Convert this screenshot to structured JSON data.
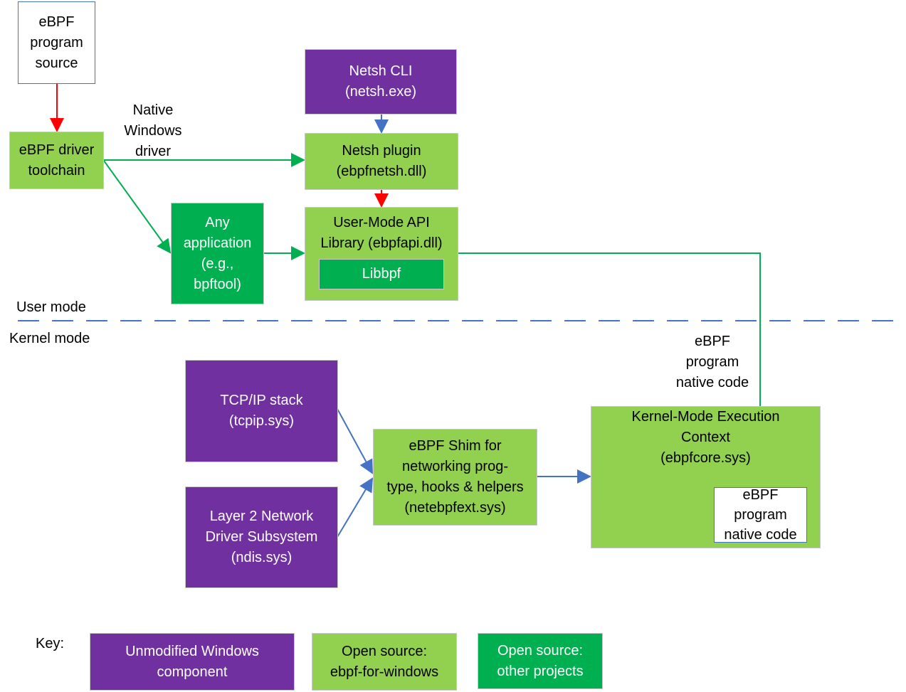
{
  "colors": {
    "unmodified": "#7030a0",
    "ebpf_for_windows": "#92d050",
    "other_projects": "#00b050",
    "arrow_blue": "#4472c4",
    "arrow_red": "#ff0000",
    "arrow_green": "#00b050"
  },
  "nodes": {
    "source": "eBPF\nprogram\nsource",
    "toolchain": "eBPF driver\ntoolchain",
    "netsh_cli": "Netsh CLI\n(netsh.exe)",
    "netsh_plugin": "Netsh plugin\n(ebpfnetsh.dll)",
    "any_app": "Any\napplication\n(e.g.,\nbpftool)",
    "api_lib": "User-Mode API\nLibrary (ebpfapi.dll)",
    "libbpf": "Libbpf",
    "tcpip": "TCP/IP stack\n(tcpip.sys)",
    "ndis": "Layer 2 Network\nDriver Subsystem\n(ndis.sys)",
    "shim": "eBPF Shim for\nnetworking prog-\ntype, hooks & helpers\n(netebpfext.sys)",
    "exec_ctx": "Kernel-Mode Execution\nContext\n(ebpfcore.sys)",
    "native_code": "eBPF\nprogram\nnative code"
  },
  "labels": {
    "native_driver": "Native\nWindows\ndriver",
    "user_mode": "User mode",
    "kernel_mode": "Kernel mode",
    "native_code_edge": "eBPF\nprogram\nnative code"
  },
  "key": {
    "title": "Key:",
    "unmodified": "Unmodified Windows\ncomponent",
    "ebpf_for_windows": "Open source:\nebpf-for-windows",
    "other_projects": "Open source:\nother projects"
  }
}
